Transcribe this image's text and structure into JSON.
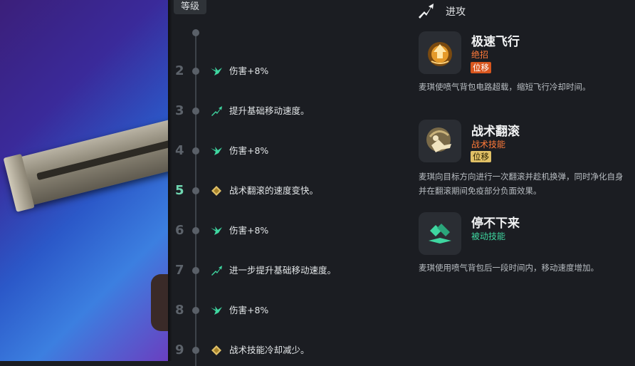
{
  "level_header": "等级",
  "levels": [
    {
      "num": "2",
      "icon": "wing-icon",
      "text": "伤害+8%"
    },
    {
      "num": "3",
      "icon": "arrow-up-icon",
      "text": "提升基础移动速度。"
    },
    {
      "num": "4",
      "icon": "wing-icon",
      "text": "伤害+8%"
    },
    {
      "num": "5",
      "icon": "diamond-icon",
      "text": "战术翻滚的速度变快。"
    },
    {
      "num": "6",
      "icon": "wing-icon",
      "text": "伤害+8%"
    },
    {
      "num": "7",
      "icon": "arrow-up-icon",
      "text": "进一步提升基础移动速度。"
    },
    {
      "num": "8",
      "icon": "wing-icon",
      "text": "伤害+8%"
    },
    {
      "num": "9",
      "icon": "diamond-icon",
      "text": "战术技能冷却减少。"
    }
  ],
  "attack_header": "进攻",
  "abilities": [
    {
      "name": "极速飞行",
      "type": "绝招",
      "badge": "位移",
      "desc": "麦琪使喷气背包电路超载，缩短飞行冷却时间。"
    },
    {
      "name": "战术翻滚",
      "type": "战术技能",
      "badge": "位移",
      "desc": "麦琪向目标方向进行一次翻滚并趁机换弹，同时净化自身并在翻滚期间免疫部分负面效果。"
    },
    {
      "name": "停不下来",
      "type": "被动技能",
      "badge": "",
      "desc": "麦琪使用喷气背包后一段时间内，移动速度增加。"
    }
  ],
  "colors": {
    "accent_green": "#3fd6a0",
    "accent_orange": "#ff7a3a",
    "badge_yellow": "#e0c066"
  }
}
